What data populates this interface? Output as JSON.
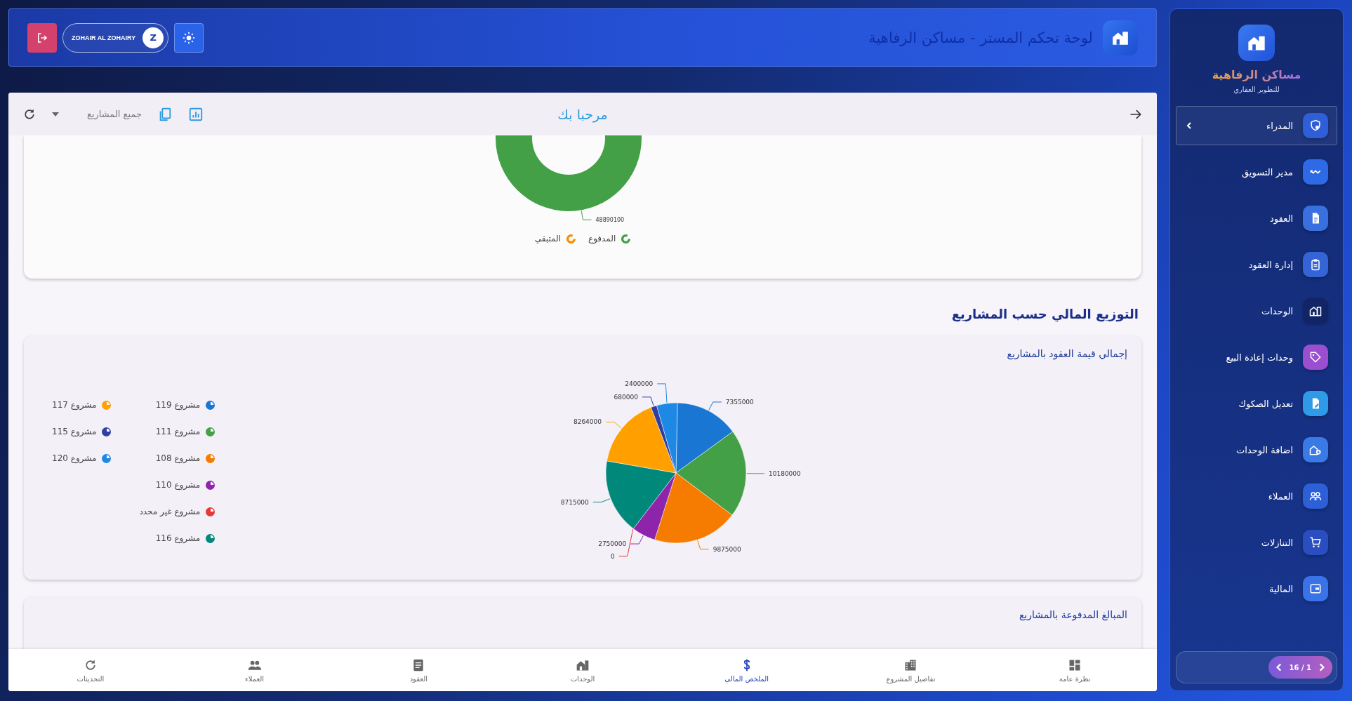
{
  "header": {
    "title": "لوحة تحكم المستر - مساكن الرفاهية",
    "user": {
      "name": "ZOHAIR AL ZOHAIRY",
      "initial": "Z"
    }
  },
  "toolbar": {
    "greeting": "مرحبا بك",
    "project_filter": "جميع المشاريع"
  },
  "payment_card": {
    "ring_label": "48890100",
    "legend": [
      {
        "label": "المدفوع",
        "color": "#43a047"
      },
      {
        "label": "المتبقي",
        "color": "#fb8c00"
      }
    ]
  },
  "section_heading": "التوزيع المالي حسب المشاريع",
  "contracts_card": {
    "chart_data": {
      "type": "pie",
      "title": "إجمالي قيمة العقود بالمشاريع",
      "categories": [
        "مشروع 119",
        "مشروع 111",
        "مشروع 108",
        "مشروع 110",
        "مشروع غير محدد",
        "مشروع 116",
        "مشروع 117",
        "مشروع 115",
        "مشروع 120"
      ],
      "values": [
        7355000,
        10180000,
        9875000,
        2750000,
        0,
        8715000,
        8264000,
        680000,
        2400000
      ],
      "colors": [
        "#1976d2",
        "#43a047",
        "#f57c00",
        "#8e24aa",
        "#e53935",
        "#00897b",
        "#ffa000",
        "#303f9f",
        "#1e88e5"
      ],
      "data_labels": true,
      "value_labels": [
        "7355000",
        "10180000",
        "9875000",
        "2750000",
        "0",
        "8715000",
        "8264000",
        "680000",
        "2400000"
      ]
    }
  },
  "paid_card": {
    "title": "المبالغ المدفوعة بالمشاريع"
  },
  "bottom_nav": [
    {
      "label": "نظرة عامة",
      "selected": false
    },
    {
      "label": "تفاصيل المشروع",
      "selected": false
    },
    {
      "label": "الملخص المالي",
      "selected": true
    },
    {
      "label": "الوحدات",
      "selected": false
    },
    {
      "label": "العقود",
      "selected": false
    },
    {
      "label": "العملاء",
      "selected": false
    },
    {
      "label": "التحديثات",
      "selected": false
    }
  ],
  "sidebar": {
    "brand": "مساكن الرفاهية",
    "subtitle": "للتطوير العقاري",
    "items": [
      {
        "label": "المدراء",
        "selected": true,
        "color": "#2f5fd8"
      },
      {
        "label": "مدير التسويق",
        "selected": false,
        "color": "#2f6ae6"
      },
      {
        "label": "العقود",
        "selected": false,
        "color": "#3a6fe0"
      },
      {
        "label": "إدارة العقود",
        "selected": false,
        "color": "#3464d6"
      },
      {
        "label": "الوحدات",
        "selected": false,
        "color": "#112466"
      },
      {
        "label": "وحدات إعادة البيع",
        "selected": false,
        "color": "#9b4fd0"
      },
      {
        "label": "تعديل الصكوك",
        "selected": false,
        "color": "#2f9be8"
      },
      {
        "label": "اضافة الوحدات",
        "selected": false,
        "color": "#3a7ae6"
      },
      {
        "label": "العملاء",
        "selected": false,
        "color": "#2d5fd6"
      },
      {
        "label": "التنازلات",
        "selected": false,
        "color": "#2a4ec0"
      },
      {
        "label": "المالية",
        "selected": false,
        "color": "#3a72e8"
      }
    ],
    "pagination": "16 / 1"
  }
}
